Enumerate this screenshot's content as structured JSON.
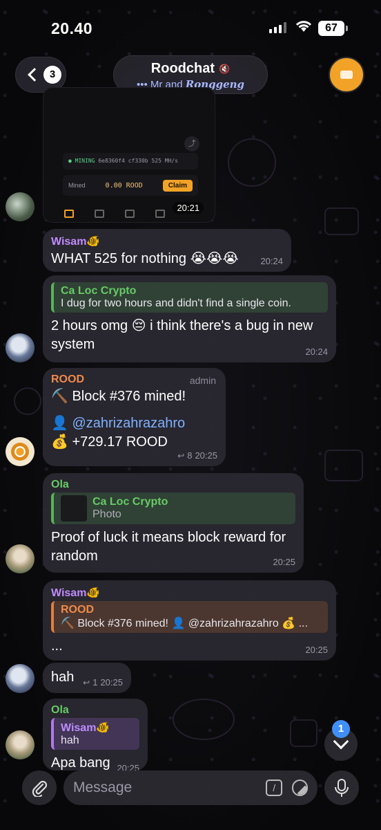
{
  "status_bar": {
    "time": "20.40",
    "battery": "67"
  },
  "header": {
    "back_count": "3",
    "chat_title": "Roodchat",
    "typing_prefix": "••• Mr and",
    "typing_name": "Ronggeng"
  },
  "image_message": {
    "mining_label": "● MINING",
    "hash": "6e8360f4 cf330b",
    "hashrate": "525 MH/s",
    "mined_label": "Mined",
    "mined_value": "0.00 ROOD",
    "claim_label": "Claim",
    "time": "20:21"
  },
  "messages": [
    {
      "sender": "Wisam🐠",
      "text": "WHAT 525 for nothing 😭😭😭",
      "time": "20:24"
    },
    {
      "reply_name": "Ca Loc Crypto",
      "reply_text": "I dug for two hours and didn't find a single coin.",
      "text": "2 hours omg 😔 i think there's a bug in new system",
      "time": "20:24"
    },
    {
      "sender": "ROOD",
      "badge": "admin",
      "line1": "⛏️ Block #376 mined!",
      "line2": "👤 @zahrizahrazahro",
      "line3": "💰 +729.17 ROOD",
      "replies": "8",
      "time": "20:25"
    },
    {
      "sender": "Ola",
      "reply_name": "Ca Loc Crypto",
      "reply_text": "Photo",
      "text": "Proof of luck it means block reward for random",
      "time": "20:25"
    },
    {
      "sender": "Wisam🐠",
      "reply_name": "ROOD",
      "reply_text": "⛏️ Block #376 mined! 👤 @zahrizahrazahro 💰 ...",
      "text": "...",
      "time": "20:25"
    },
    {
      "text": "hah",
      "replies": "1",
      "time": "20:25"
    },
    {
      "sender": "Ola",
      "reply_name": "Wisam🐠",
      "reply_text": "hah",
      "text": "Apa bang",
      "time": "20:25"
    }
  ],
  "scroll_badge": "1",
  "composer": {
    "placeholder": "Message",
    "command_icon": "/"
  }
}
